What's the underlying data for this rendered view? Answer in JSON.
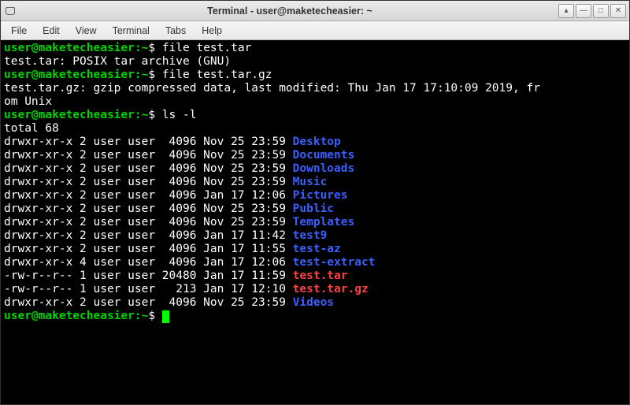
{
  "window": {
    "title": "Terminal - user@maketecheasier: ~",
    "app_icon": "🖵"
  },
  "controls": {
    "up": "▴",
    "min": "—",
    "max": "□",
    "close": "✕"
  },
  "menu": {
    "file": "File",
    "edit": "Edit",
    "view": "View",
    "terminal": "Terminal",
    "tabs": "Tabs",
    "help": "Help"
  },
  "prompt": {
    "userhost": "user@maketecheasier",
    "path": "~",
    "symbol": "$"
  },
  "cmds": {
    "c1": "file test.tar",
    "c2": "file test.tar.gz",
    "c3": "ls -l"
  },
  "output": {
    "file1": "test.tar: POSIX tar archive (GNU)",
    "file2": "test.tar.gz: gzip compressed data, last modified: Thu Jan 17 17:10:09 2019, fr",
    "file2b": "om Unix",
    "total": "total 68"
  },
  "ls": [
    {
      "perm": "drwxr-xr-x 2 user user  4096 Nov 25 23:59 ",
      "name": "Desktop",
      "cls": "dir"
    },
    {
      "perm": "drwxr-xr-x 2 user user  4096 Nov 25 23:59 ",
      "name": "Documents",
      "cls": "dir"
    },
    {
      "perm": "drwxr-xr-x 2 user user  4096 Nov 25 23:59 ",
      "name": "Downloads",
      "cls": "dir"
    },
    {
      "perm": "drwxr-xr-x 2 user user  4096 Nov 25 23:59 ",
      "name": "Music",
      "cls": "dir"
    },
    {
      "perm": "drwxr-xr-x 2 user user  4096 Jan 17 12:06 ",
      "name": "Pictures",
      "cls": "dir"
    },
    {
      "perm": "drwxr-xr-x 2 user user  4096 Nov 25 23:59 ",
      "name": "Public",
      "cls": "dir"
    },
    {
      "perm": "drwxr-xr-x 2 user user  4096 Nov 25 23:59 ",
      "name": "Templates",
      "cls": "dir"
    },
    {
      "perm": "drwxr-xr-x 2 user user  4096 Jan 17 11:42 ",
      "name": "test9",
      "cls": "dir"
    },
    {
      "perm": "drwxr-xr-x 2 user user  4096 Jan 17 11:55 ",
      "name": "test-az",
      "cls": "dir"
    },
    {
      "perm": "drwxr-xr-x 4 user user  4096 Jan 17 12:06 ",
      "name": "test-extract",
      "cls": "dir"
    },
    {
      "perm": "-rw-r--r-- 1 user user 20480 Jan 17 11:59 ",
      "name": "test.tar",
      "cls": "arch"
    },
    {
      "perm": "-rw-r--r-- 1 user user   213 Jan 17 12:10 ",
      "name": "test.tar.gz",
      "cls": "arch"
    },
    {
      "perm": "drwxr-xr-x 2 user user  4096 Nov 25 23:59 ",
      "name": "Videos",
      "cls": "dir"
    }
  ]
}
